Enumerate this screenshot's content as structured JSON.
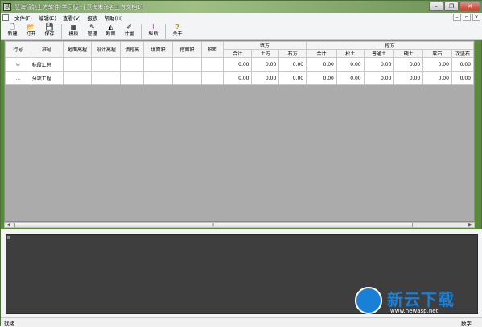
{
  "window": {
    "title": "慧海智能土方软件-学习版 - [慧海未命名土方文档1]",
    "icon": "app-logo-icon",
    "controls": [
      "minimize",
      "restore",
      "close"
    ]
  },
  "menu": {
    "items": [
      "文件(F)",
      "编辑(E)",
      "查看(V)",
      "报表",
      "帮助(H)"
    ]
  },
  "toolbar": {
    "buttons": [
      {
        "label": "新建",
        "icon": "new-file-icon",
        "glyph": "🗋"
      },
      {
        "label": "打开",
        "icon": "open-folder-icon",
        "glyph": "📂"
      },
      {
        "label": "保存",
        "icon": "save-icon",
        "glyph": "💾"
      },
      {
        "label": "模板",
        "icon": "template-icon",
        "glyph": "▦"
      },
      {
        "label": "管理",
        "icon": "manage-icon",
        "glyph": "✎"
      },
      {
        "label": "断面",
        "icon": "section-icon",
        "glyph": "◭"
      },
      {
        "label": "计量",
        "icon": "measure-icon",
        "glyph": "✐"
      },
      {
        "label": "纵断",
        "icon": "profile-icon",
        "glyph": "⌇"
      },
      {
        "label": "关于",
        "icon": "help-icon",
        "glyph": "?"
      }
    ]
  },
  "grid": {
    "columns": {
      "row_no": "行号",
      "stake": "桩号",
      "ground_elev": "地面高程",
      "design_elev": "设计高程",
      "fill_cut_height": "填挖高",
      "fill_area": "填面积",
      "cut_area": "挖面积",
      "stake_dist": "桩距",
      "fill_group": "填方",
      "cut_group": "挖方"
    },
    "fill_sub": [
      "合计",
      "土方",
      "石方"
    ],
    "cut_sub": [
      "合计",
      "松土",
      "普通土",
      "硬土",
      "软石",
      "次坚石"
    ],
    "rows": [
      {
        "lead": "⊖",
        "stake": "标段汇总",
        "values": [
          "0.00",
          "0.00",
          "0.00",
          "0.00",
          "0.00",
          "0.00",
          "0.00",
          "0.00",
          "0.00"
        ]
      },
      {
        "lead": "…",
        "stake": "分项工程",
        "values": [
          "0.00",
          "0.00",
          "0.00",
          "0.00",
          "0.00",
          "0.00",
          "0.00",
          "0.00",
          "0.00"
        ]
      }
    ]
  },
  "scrollbar": {
    "grip": "⦀"
  },
  "status": {
    "left": "就绪",
    "right": "数字"
  },
  "watermark": {
    "text": "新云下载",
    "url": "www.newasp.net"
  }
}
